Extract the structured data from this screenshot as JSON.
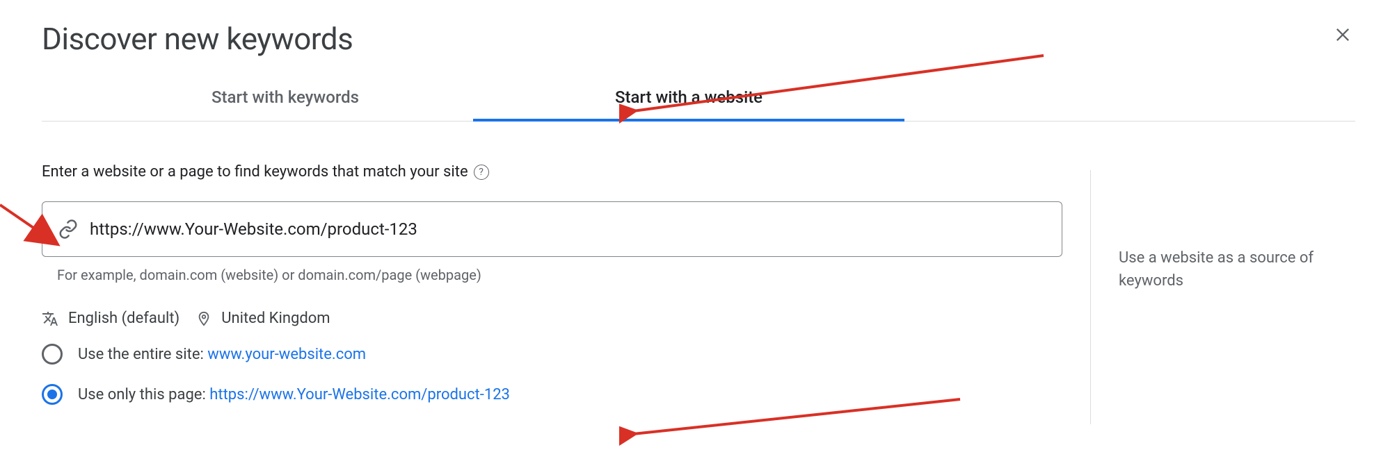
{
  "header": {
    "title": "Discover new keywords"
  },
  "tabs": {
    "keywords": "Start with keywords",
    "website": "Start with a website",
    "active": "website"
  },
  "field": {
    "label": "Enter a website or a page to find keywords that match your site",
    "value": "https://www.Your-Website.com/product-123",
    "hint": "For example, domain.com (website) or domain.com/page (webpage)"
  },
  "locale": {
    "language": "English (default)",
    "location": "United Kingdom"
  },
  "options": {
    "entire_label": "Use the entire site: ",
    "entire_url": "www.your-website.com",
    "page_label": "Use only this page: ",
    "page_url": "https://www.Your-Website.com/product-123",
    "selected": "page"
  },
  "sidebar": {
    "tip": "Use a website as a source of keywords"
  }
}
